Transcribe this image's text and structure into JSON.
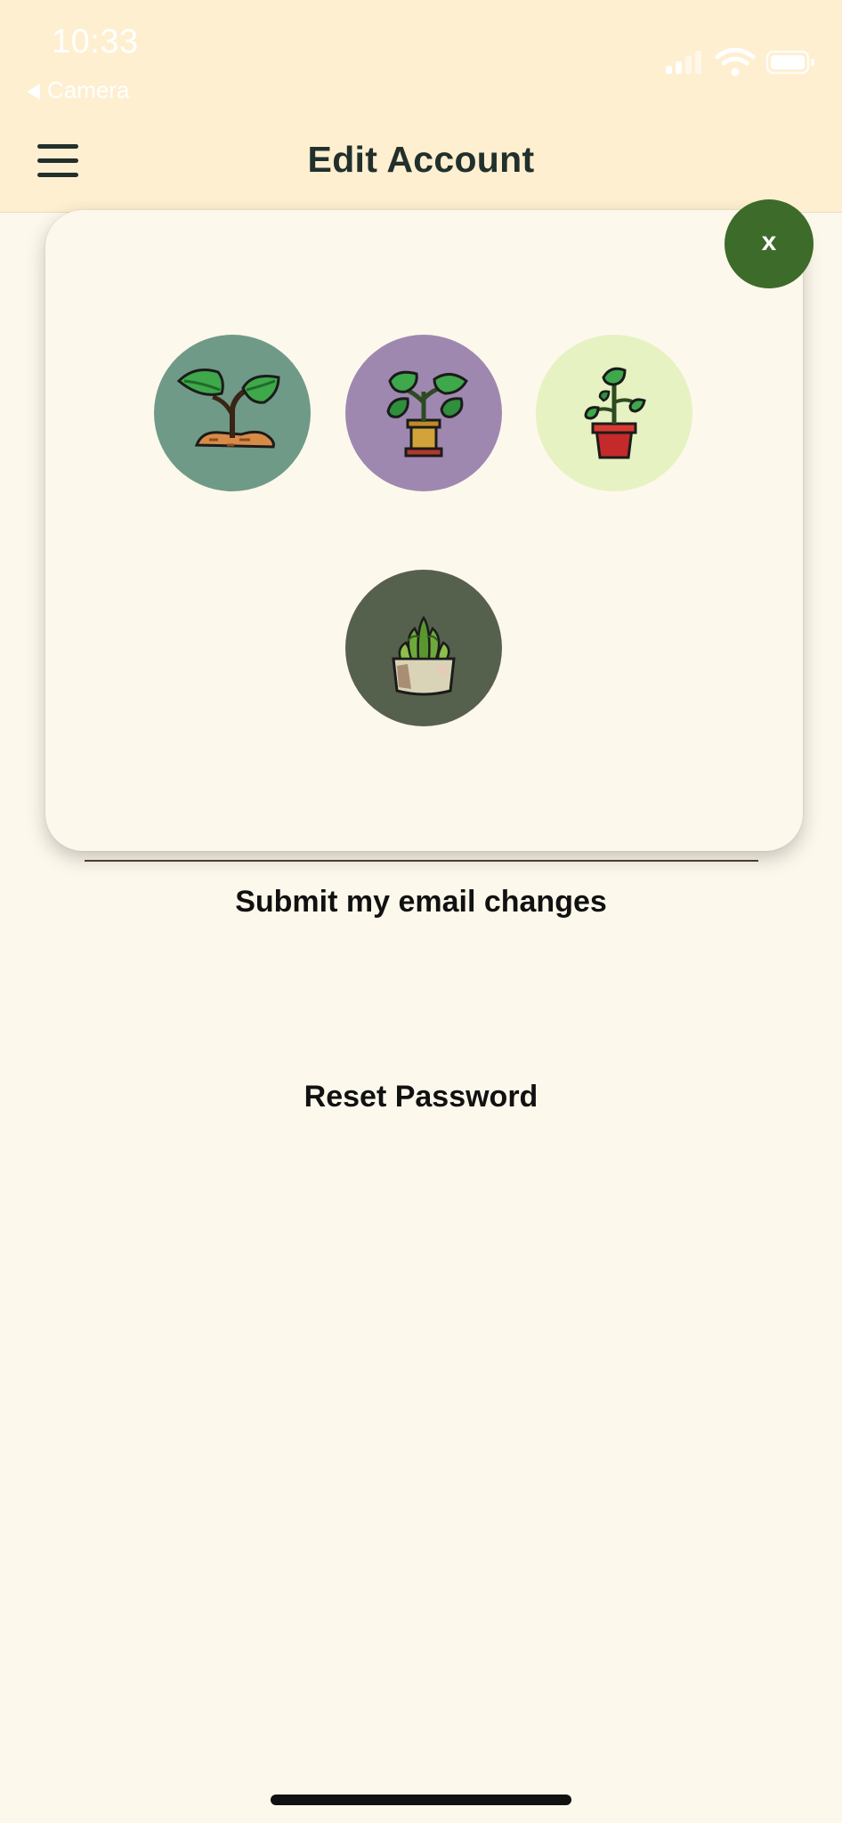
{
  "status_bar": {
    "time": "10:33",
    "back_label": "Camera"
  },
  "header": {
    "title": "Edit Account"
  },
  "avatar_modal": {
    "close_label": "x",
    "options": [
      {
        "icon": "sprout-in-soil-icon",
        "bg_color": "#6f9a87"
      },
      {
        "icon": "potted-leafy-plant-icon",
        "bg_color": "#9f88b0"
      },
      {
        "icon": "red-pot-plant-icon",
        "bg_color": "#e6f2c2"
      },
      {
        "icon": "succulent-pot-icon",
        "bg_color": "#56614d"
      }
    ]
  },
  "actions": {
    "submit_email_label": "Submit my email changes",
    "reset_password_label": "Reset Password"
  },
  "colors": {
    "header_bg": "#feefd0",
    "page_bg": "#fdf8ec",
    "close_button": "#3d6b29",
    "title_text": "#22302c"
  }
}
